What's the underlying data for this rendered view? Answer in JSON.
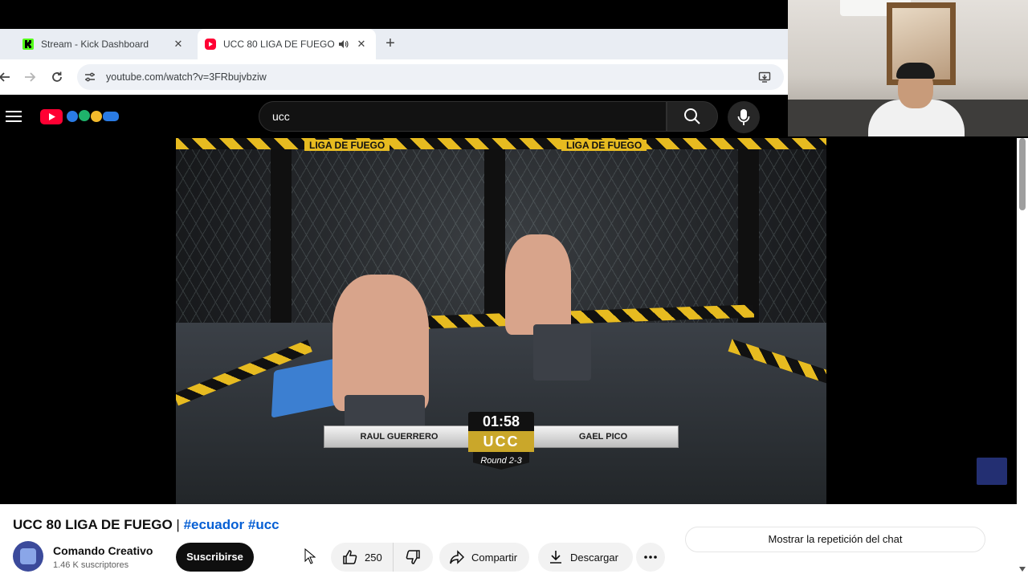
{
  "browser": {
    "tabs": [
      {
        "title": "Stream - Kick Dashboard",
        "favicon_color": "#53fc18",
        "active": false
      },
      {
        "title": "UCC 80 LIGA DE FUEGO | #e",
        "favicon_color": "#ff0033",
        "active": true
      }
    ],
    "new_tab_icon": "plus-icon",
    "url": "youtube.com/watch?v=3FRbujvbziw"
  },
  "youtube": {
    "search_query": "ucc",
    "brand_color": "#ff0033"
  },
  "video": {
    "cage_banner_text": "LIGA DE FUEGO",
    "scoreboard": {
      "time": "01:58",
      "logo_text": "UCC",
      "round": "Round 2-3",
      "fighter_left": "RAUL GUERRERO",
      "fighter_right": "GAEL PICO"
    }
  },
  "info": {
    "title": "UCC 80 LIGA DE FUEGO",
    "title_separator": "|",
    "hashtags": [
      "#ecuador",
      "#ucc"
    ],
    "hashtag_color": "#065fd4",
    "channel_name": "Comando Creativo",
    "subscribers": "1.46 K suscriptores",
    "subscribe_label": "Suscribirse",
    "like_count": "250",
    "share_label": "Compartir",
    "download_label": "Descargar",
    "chat_replay_label": "Mostrar la repetición del chat"
  }
}
